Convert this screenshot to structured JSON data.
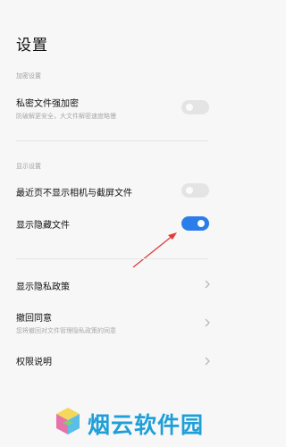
{
  "page": {
    "title": "设置"
  },
  "sections": {
    "encryption": {
      "label": "加密设置",
      "items": [
        {
          "title": "私密文件强加密",
          "subtitle": "防破解更安全，大文件解密速度略慢",
          "toggle": "off"
        }
      ]
    },
    "display": {
      "label": "显示设置",
      "items": [
        {
          "title": "最近页不显示相机与截屏文件",
          "toggle": "off"
        },
        {
          "title": "显示隐藏文件",
          "toggle": "on"
        }
      ]
    },
    "links": [
      {
        "title": "显示隐私政策"
      },
      {
        "title": "撤回同意",
        "subtitle": "您将撤回对文件管理隐私政策的同意"
      },
      {
        "title": "权限说明"
      }
    ]
  },
  "colors": {
    "toggle_on": "#2b7de9",
    "toggle_off": "#e4e4e4",
    "annotation_arrow": "#e03a3a",
    "watermark_text": "#1f9fd8"
  },
  "icons": {
    "chevron": "chevron-right-icon",
    "annotation": "red-arrow-icon",
    "watermark_logo": "cube-logo-icon"
  },
  "watermark": {
    "text": "烟云软件园"
  }
}
